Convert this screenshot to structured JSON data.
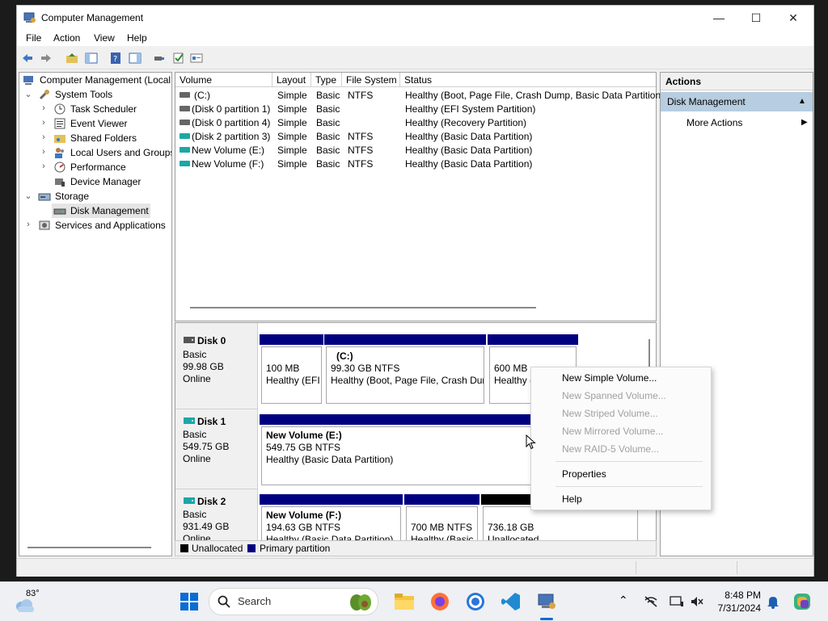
{
  "window": {
    "title": "Computer Management",
    "minimize": "—",
    "maximize": "☐",
    "close": "✕"
  },
  "menu": [
    "File",
    "Action",
    "View",
    "Help"
  ],
  "tree": {
    "root": "Computer Management (Local",
    "system_tools": "System Tools",
    "task_scheduler": "Task Scheduler",
    "event_viewer": "Event Viewer",
    "shared_folders": "Shared Folders",
    "local_users": "Local Users and Groups",
    "performance": "Performance",
    "device_manager": "Device Manager",
    "storage": "Storage",
    "disk_management": "Disk Management",
    "services": "Services and Applications"
  },
  "volume_table": {
    "columns": [
      "Volume",
      "Layout",
      "Type",
      "File System",
      "Status"
    ],
    "rows": [
      {
        "volume": "(C:)",
        "layout": "Simple",
        "type": "Basic",
        "fs": "NTFS",
        "status": "Healthy (Boot, Page File, Crash Dump, Basic Data Partition)"
      },
      {
        "volume": "(Disk 0 partition 1)",
        "layout": "Simple",
        "type": "Basic",
        "fs": "",
        "status": "Healthy (EFI System Partition)"
      },
      {
        "volume": "(Disk 0 partition 4)",
        "layout": "Simple",
        "type": "Basic",
        "fs": "",
        "status": "Healthy (Recovery Partition)"
      },
      {
        "volume": "(Disk 2 partition 3)",
        "layout": "Simple",
        "type": "Basic",
        "fs": "NTFS",
        "status": "Healthy (Basic Data Partition)"
      },
      {
        "volume": "New Volume (E:)",
        "layout": "Simple",
        "type": "Basic",
        "fs": "NTFS",
        "status": "Healthy (Basic Data Partition)"
      },
      {
        "volume": "New Volume (F:)",
        "layout": "Simple",
        "type": "Basic",
        "fs": "NTFS",
        "status": "Healthy (Basic Data Partition)"
      }
    ]
  },
  "disks": {
    "disk0": {
      "name": "Disk 0",
      "type": "Basic",
      "size": "99.98 GB",
      "status": "Online",
      "p1": {
        "size": "100 MB",
        "status": "Healthy (EFI"
      },
      "p2": {
        "name": "(C:)",
        "size": "99.30 GB NTFS",
        "status": "Healthy (Boot, Page File, Crash Dur"
      },
      "p3": {
        "size": "600 MB",
        "status": "Healthy ("
      }
    },
    "disk1": {
      "name": "Disk 1",
      "type": "Basic",
      "size": "549.75 GB",
      "status": "Online",
      "p1": {
        "name": "New Volume  (E:)",
        "size": "549.75 GB NTFS",
        "status": "Healthy (Basic Data Partition)"
      }
    },
    "disk2": {
      "name": "Disk 2",
      "type": "Basic",
      "size": "931.49 GB",
      "status": "Online",
      "p1": {
        "name": "New Volume  (F:)",
        "size": "194.63 GB NTFS",
        "status": "Healthy (Basic Data Partition)"
      },
      "p2": {
        "size": "700 MB NTFS",
        "status": "Healthy (Basic"
      },
      "p3": {
        "size": "736.18 GB",
        "status": "Unallocated"
      }
    }
  },
  "legend": {
    "unallocated": "Unallocated",
    "primary": "Primary partition"
  },
  "actions": {
    "header": "Actions",
    "section": "Disk Management",
    "more": "More Actions"
  },
  "context_menu": {
    "new_simple": "New Simple Volume...",
    "new_spanned": "New Spanned Volume...",
    "new_striped": "New Striped Volume...",
    "new_mirrored": "New Mirrored Volume...",
    "new_raid5": "New RAID-5 Volume...",
    "properties": "Properties",
    "help": "Help"
  },
  "taskbar": {
    "weather": "83°",
    "search": "Search",
    "time": "8:48 PM",
    "date": "7/31/2024"
  },
  "colors": {
    "primary_partition": "#00007f",
    "unallocated": "#000000",
    "selected_action": "#b7cde0",
    "window_bg": "#f0f0f0"
  }
}
